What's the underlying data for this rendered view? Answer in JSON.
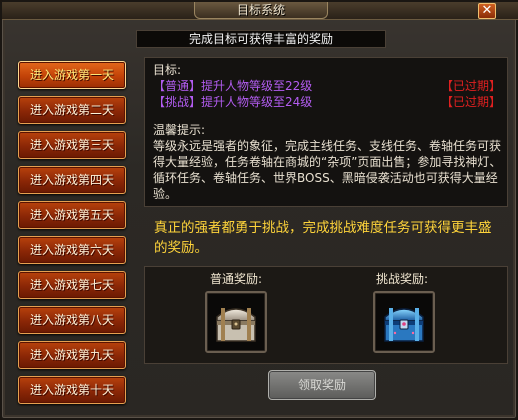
{
  "window": {
    "title": "目标系统"
  },
  "header": {
    "banner": "完成目标可获得丰富的奖励"
  },
  "day_tabs": [
    {
      "label": "进入游戏第一天",
      "active": true
    },
    {
      "label": "进入游戏第二天",
      "active": false
    },
    {
      "label": "进入游戏第三天",
      "active": false
    },
    {
      "label": "进入游戏第四天",
      "active": false
    },
    {
      "label": "进入游戏第五天",
      "active": false
    },
    {
      "label": "进入游戏第六天",
      "active": false
    },
    {
      "label": "进入游戏第七天",
      "active": false
    },
    {
      "label": "进入游戏第八天",
      "active": false
    },
    {
      "label": "进入游戏第九天",
      "active": false
    },
    {
      "label": "进入游戏第十天",
      "active": false
    }
  ],
  "goals": {
    "label": "目标:",
    "items": [
      {
        "text": "【普通】提升人物等级至22级",
        "status": "【已过期】"
      },
      {
        "text": "【挑战】提升人物等级至24级",
        "status": "【已过期】"
      }
    ]
  },
  "tips": {
    "label": "温馨提示:",
    "body": "等级永远是强者的象征，完成主线任务、支线任务、卷轴任务可获得大量经验，任务卷轴在商城的“杂项”页面出售；参加寻找神灯、循环任务、卷轴任务、世界BOSS、黑暗侵袭活动也可获得大量经验。"
  },
  "slogan": "真正的强者都勇于挑战，完成挑战难度任务可获得更丰盛的奖励。",
  "rewards": {
    "normal_label": "普通奖励:",
    "challenge_label": "挑战奖励:",
    "normal_icon": "silver-chest-icon",
    "challenge_icon": "blue-chest-icon"
  },
  "claim_button": "领取奖励",
  "colors": {
    "goal_text": "#b25cf0",
    "expired": "#e02020",
    "slogan": "#ffd43a",
    "tab_active_text": "#ffe97a"
  }
}
